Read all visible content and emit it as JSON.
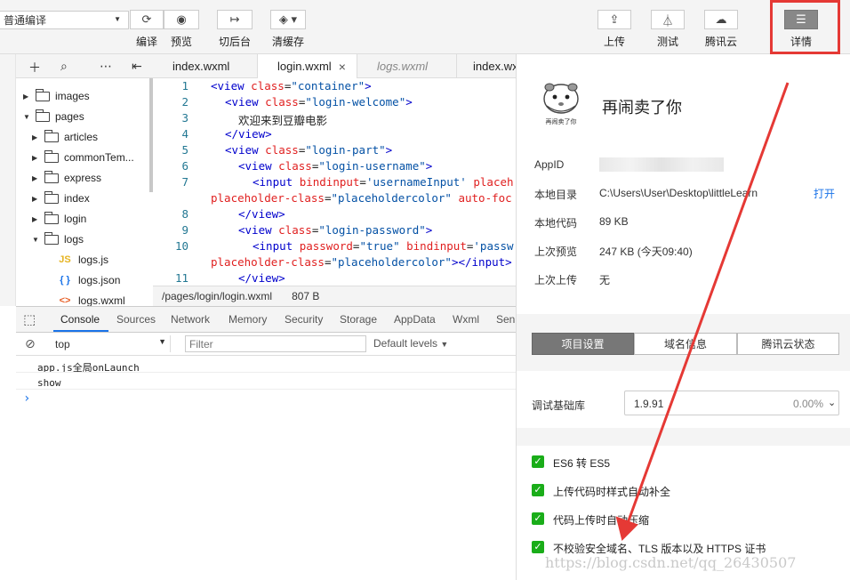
{
  "toolbar": {
    "mode": "普通编译",
    "buttons": [
      {
        "icon": "refresh-icon",
        "label": "编译"
      },
      {
        "icon": "eye-icon",
        "label": "预览"
      },
      {
        "icon": "switch-background-icon",
        "label": "切后台"
      },
      {
        "icon": "layers-icon",
        "label": "清缓存"
      },
      {
        "icon": "upload-icon",
        "label": "上传"
      },
      {
        "icon": "flask-icon",
        "label": "测试"
      },
      {
        "icon": "cloud-icon",
        "label": "腾讯云"
      },
      {
        "icon": "menu-icon",
        "label": "详情"
      }
    ]
  },
  "explorer": {
    "tree": [
      {
        "label": "images",
        "type": "folder",
        "expanded": false,
        "depth": 0
      },
      {
        "label": "pages",
        "type": "folder",
        "expanded": true,
        "depth": 0
      },
      {
        "label": "articles",
        "type": "folder",
        "expanded": false,
        "depth": 1
      },
      {
        "label": "commonTem...",
        "type": "folder",
        "expanded": false,
        "depth": 1
      },
      {
        "label": "express",
        "type": "folder",
        "expanded": false,
        "depth": 1
      },
      {
        "label": "index",
        "type": "folder",
        "expanded": false,
        "depth": 1
      },
      {
        "label": "login",
        "type": "folder",
        "expanded": false,
        "depth": 1
      },
      {
        "label": "logs",
        "type": "folder",
        "expanded": true,
        "depth": 1
      },
      {
        "label": "logs.js",
        "type": "js",
        "badge": "JS",
        "depth": 2
      },
      {
        "label": "logs.json",
        "type": "json",
        "badge": "{ }",
        "depth": 2
      },
      {
        "label": "logs.wxml",
        "type": "wxml",
        "badge": "<>",
        "depth": 2
      }
    ]
  },
  "editor": {
    "tabs": [
      {
        "label": "index.wxml",
        "active": false,
        "italic": false
      },
      {
        "label": "login.wxml",
        "active": true,
        "italic": false,
        "close": "×"
      },
      {
        "label": "logs.wxml",
        "active": false,
        "italic": true
      },
      {
        "label": "index.wx",
        "active": false,
        "italic": false
      }
    ],
    "line_numbers": [
      "1",
      "2",
      "3",
      "4",
      "5",
      "6",
      "7",
      "",
      "8",
      "9",
      "10",
      "",
      "11"
    ],
    "status_path": "/pages/login/login.wxml",
    "status_size": "807 B"
  },
  "devtools": {
    "tabs": [
      "Console",
      "Sources",
      "Network",
      "Memory",
      "Security",
      "Storage",
      "AppData",
      "Wxml",
      "Sen"
    ],
    "active_tab": "Console",
    "context": "top",
    "filter_placeholder": "Filter",
    "levels": "Default levels",
    "console_lines": [
      "app.js全局onLaunch",
      "show"
    ],
    "prompt": "›"
  },
  "details": {
    "app_name": "再闹卖了你",
    "logo_caption": "再闹卖了你",
    "info": [
      {
        "label": "AppID",
        "value": ""
      },
      {
        "label": "本地目录",
        "value": "C:\\Users\\User\\Desktop\\littleLearn"
      },
      {
        "label": "本地代码",
        "value": "89 KB"
      },
      {
        "label": "上次预览",
        "value": "247 KB (今天09:40)"
      },
      {
        "label": "上次上传",
        "value": "无"
      }
    ],
    "open_link": "打开",
    "segments": [
      "项目设置",
      "域名信息",
      "腾讯云状态"
    ],
    "base_lib_label": "调试基础库",
    "base_lib_version": "1.9.91",
    "base_lib_pct": "0.00%",
    "options": [
      {
        "label": "ES6 转 ES5",
        "checked": true
      },
      {
        "label": "上传代码时样式自动补全",
        "checked": true
      },
      {
        "label": "代码上传时自动压缩",
        "checked": true
      },
      {
        "label": "不校验安全域名、TLS 版本以及 HTTPS 证书",
        "checked": true
      }
    ]
  },
  "watermark": "https://blog.csdn.net/qq_26430507",
  "colors": {
    "highlight": "#e53935",
    "checkbox": "#1aad19",
    "link": "#1a73e8"
  }
}
